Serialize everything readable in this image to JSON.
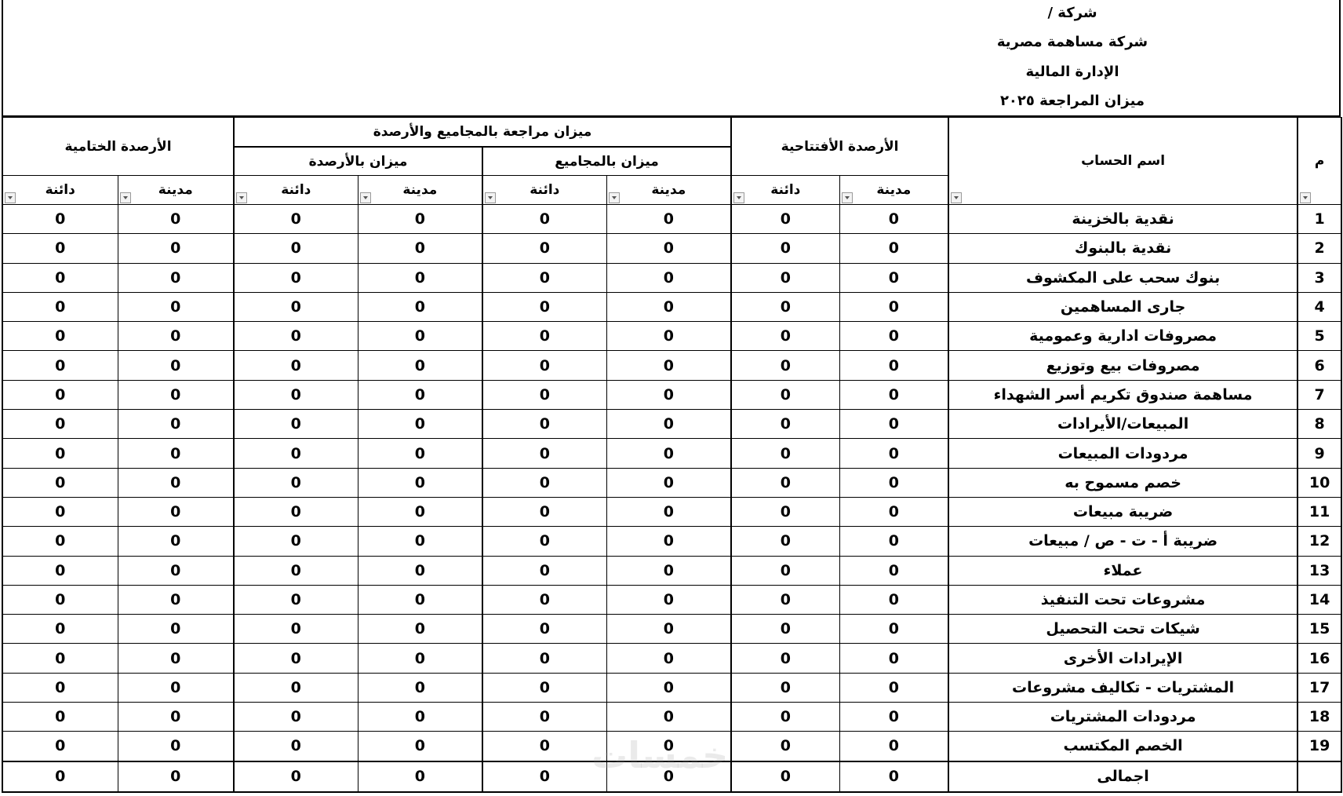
{
  "header": {
    "company_line": "شركة /",
    "company_type": "شركة مساهمة مصرية",
    "department": "الإدارة المالية",
    "report_title": "ميزان المراجعة ٢٠٢٥"
  },
  "columns": {
    "index": "م",
    "account_name": "اسم الحساب",
    "opening_balances": "الأرصدة الأفتتاحية",
    "trial_balance_group": "ميزان مراجعة بالمجاميع والأرصدة",
    "totals_balance": "ميزان بالمجاميع",
    "balances_balance": "ميزان بالأرصدة",
    "closing_balances": "الأرصدة الختامية",
    "debit": "مدينة",
    "credit": "دائنة"
  },
  "rows": [
    {
      "index": "1",
      "name": "نقدية بالخزينة",
      "values": [
        "0",
        "0",
        "0",
        "0",
        "0",
        "0",
        "0",
        "0"
      ]
    },
    {
      "index": "2",
      "name": "نقدية بالبنوك",
      "values": [
        "0",
        "0",
        "0",
        "0",
        "0",
        "0",
        "0",
        "0"
      ]
    },
    {
      "index": "3",
      "name": "بنوك سحب على المكشوف",
      "values": [
        "0",
        "0",
        "0",
        "0",
        "0",
        "0",
        "0",
        "0"
      ]
    },
    {
      "index": "4",
      "name": "جارى المساهمين",
      "values": [
        "0",
        "0",
        "0",
        "0",
        "0",
        "0",
        "0",
        "0"
      ]
    },
    {
      "index": "5",
      "name": "مصروفات ادارية وعمومية",
      "values": [
        "0",
        "0",
        "0",
        "0",
        "0",
        "0",
        "0",
        "0"
      ]
    },
    {
      "index": "6",
      "name": "مصروفات بيع وتوزيع",
      "values": [
        "0",
        "0",
        "0",
        "0",
        "0",
        "0",
        "0",
        "0"
      ]
    },
    {
      "index": "7",
      "name": "مساهمة صندوق تكريم أسر الشهداء",
      "values": [
        "0",
        "0",
        "0",
        "0",
        "0",
        "0",
        "0",
        "0"
      ]
    },
    {
      "index": "8",
      "name": "المبيعات/الأيرادات",
      "values": [
        "0",
        "0",
        "0",
        "0",
        "0",
        "0",
        "0",
        "0"
      ]
    },
    {
      "index": "9",
      "name": "مردودات المبيعات",
      "values": [
        "0",
        "0",
        "0",
        "0",
        "0",
        "0",
        "0",
        "0"
      ]
    },
    {
      "index": "10",
      "name": "خصم مسموح به",
      "values": [
        "0",
        "0",
        "0",
        "0",
        "0",
        "0",
        "0",
        "0"
      ]
    },
    {
      "index": "11",
      "name": "ضريبة مبيعات",
      "values": [
        "0",
        "0",
        "0",
        "0",
        "0",
        "0",
        "0",
        "0"
      ]
    },
    {
      "index": "12",
      "name": "ضريبة أ - ت - ص / مبيعات",
      "values": [
        "0",
        "0",
        "0",
        "0",
        "0",
        "0",
        "0",
        "0"
      ]
    },
    {
      "index": "13",
      "name": "عملاء",
      "values": [
        "0",
        "0",
        "0",
        "0",
        "0",
        "0",
        "0",
        "0"
      ]
    },
    {
      "index": "14",
      "name": "مشروعات تحت التنفيذ",
      "values": [
        "0",
        "0",
        "0",
        "0",
        "0",
        "0",
        "0",
        "0"
      ]
    },
    {
      "index": "15",
      "name": "شيكات تحت التحصيل",
      "values": [
        "0",
        "0",
        "0",
        "0",
        "0",
        "0",
        "0",
        "0"
      ]
    },
    {
      "index": "16",
      "name": "الإيرادات الأخرى",
      "values": [
        "0",
        "0",
        "0",
        "0",
        "0",
        "0",
        "0",
        "0"
      ]
    },
    {
      "index": "17",
      "name": "المشتريات - تكاليف مشروعات",
      "values": [
        "0",
        "0",
        "0",
        "0",
        "0",
        "0",
        "0",
        "0"
      ]
    },
    {
      "index": "18",
      "name": "مردودات المشتريات",
      "values": [
        "0",
        "0",
        "0",
        "0",
        "0",
        "0",
        "0",
        "0"
      ]
    },
    {
      "index": "19",
      "name": "الخصم المكتسب",
      "values": [
        "0",
        "0",
        "0",
        "0",
        "0",
        "0",
        "0",
        "0"
      ]
    }
  ],
  "total": {
    "label": "اجمالى",
    "values": [
      "0",
      "0",
      "0",
      "0",
      "0",
      "0",
      "0",
      "0"
    ]
  },
  "watermark": "خمسات"
}
